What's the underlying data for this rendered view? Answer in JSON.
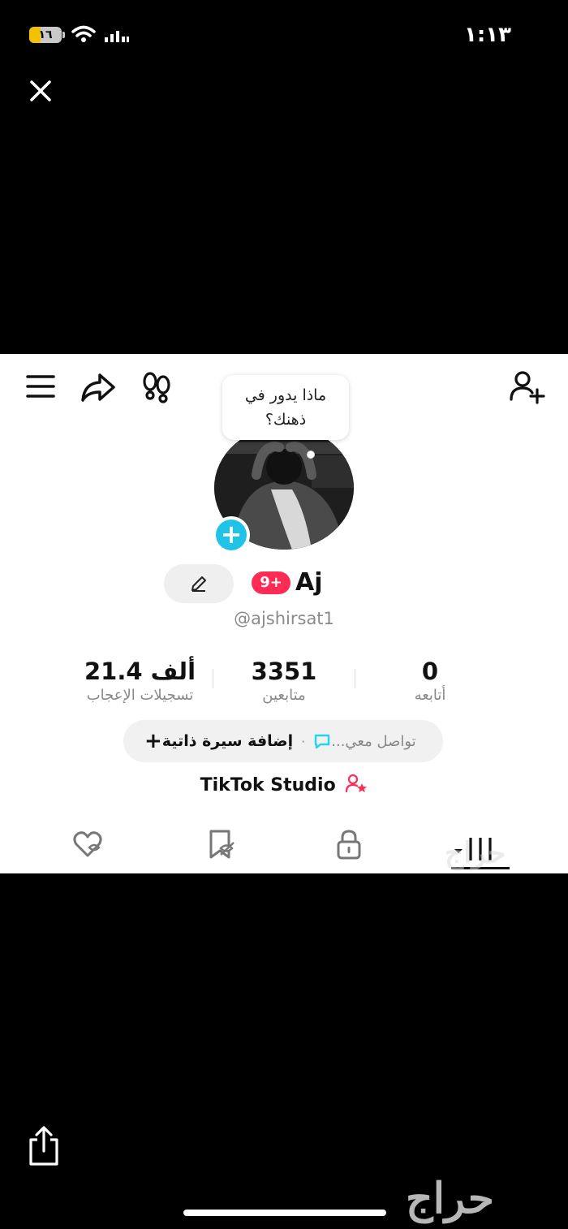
{
  "status_bar": {
    "battery": "١٦",
    "time": "١:١٣"
  },
  "icons": {
    "close": "close-icon",
    "menu": "hamburger-icon",
    "share": "share-arrow-icon",
    "footprints": "footprints-icon",
    "add_friend": "add-user-icon",
    "edit": "pencil-icon",
    "comment": "chat-bubble-icon",
    "studio": "creator-star-icon",
    "ios_share": "share-up-icon"
  },
  "profile": {
    "note_bubble": "ماذا يدور في ذهنك؟",
    "inbox_badge": "9+",
    "display_name": "Aj",
    "handle": "@ajshirsat1"
  },
  "stats": {
    "likes_value": "21.4 ألف",
    "likes_label": "تسجيلات الإعجاب",
    "followers_value": "3351",
    "followers_label": "متابعين",
    "following_value": "0",
    "following_label": "أتابعه"
  },
  "bio": {
    "plus": "+",
    "add_bio": "إضافة سيرة ذاتية",
    "separator": "·",
    "contact": "تواصل معي..."
  },
  "studio_label": "TikTok Studio",
  "tabs": [
    "videos-grid-icon",
    "private-lock-icon",
    "reposts-icon",
    "liked-hidden-icon"
  ],
  "watermark": "حراج",
  "colors": {
    "badge": "#fe2c55",
    "add_avatar": "#1fc3e6",
    "chat_icon": "#20d5ec",
    "studio_icon": "#fe2c55"
  }
}
